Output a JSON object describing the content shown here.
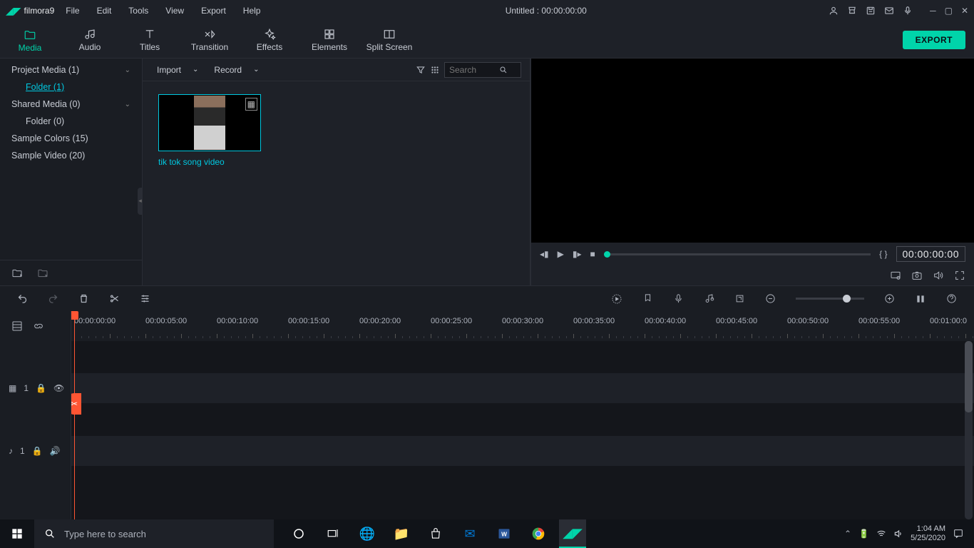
{
  "app": {
    "name": "filmora",
    "version": "9"
  },
  "menu": [
    "File",
    "Edit",
    "Tools",
    "View",
    "Export",
    "Help"
  ],
  "title": "Untitled : 00:00:00:00",
  "export_label": "EXPORT",
  "tabs": [
    {
      "label": "Media",
      "icon": "folder"
    },
    {
      "label": "Audio",
      "icon": "musicnote"
    },
    {
      "label": "Titles",
      "icon": "text"
    },
    {
      "label": "Transition",
      "icon": "transition"
    },
    {
      "label": "Effects",
      "icon": "sparkle"
    },
    {
      "label": "Elements",
      "icon": "elements"
    },
    {
      "label": "Split Screen",
      "icon": "split"
    }
  ],
  "active_tab": 0,
  "tree": [
    {
      "label": "Project Media (1)",
      "expandable": true
    },
    {
      "label": "Folder (1)",
      "sub": true,
      "active": true
    },
    {
      "label": "Shared Media (0)",
      "expandable": true
    },
    {
      "label": "Folder (0)",
      "sub": true
    },
    {
      "label": "Sample Colors (15)"
    },
    {
      "label": "Sample Video (20)"
    }
  ],
  "browser": {
    "import": "Import",
    "record": "Record",
    "search_placeholder": "Search"
  },
  "clip": {
    "name": "tik tok song video"
  },
  "preview": {
    "timecode": "00:00:00:00",
    "brackets": "{   }"
  },
  "ruler_labels": [
    "00:00:00:00",
    "00:00:05:00",
    "00:00:10:00",
    "00:00:15:00",
    "00:00:20:00",
    "00:00:25:00",
    "00:00:30:00",
    "00:00:35:00",
    "00:00:40:00",
    "00:00:45:00",
    "00:00:50:00",
    "00:00:55:00",
    "00:01:00:0"
  ],
  "track_video": "1",
  "track_audio": "1",
  "taskbar": {
    "search_placeholder": "Type here to search",
    "time": "1:04 AM",
    "date": "5/25/2020"
  }
}
